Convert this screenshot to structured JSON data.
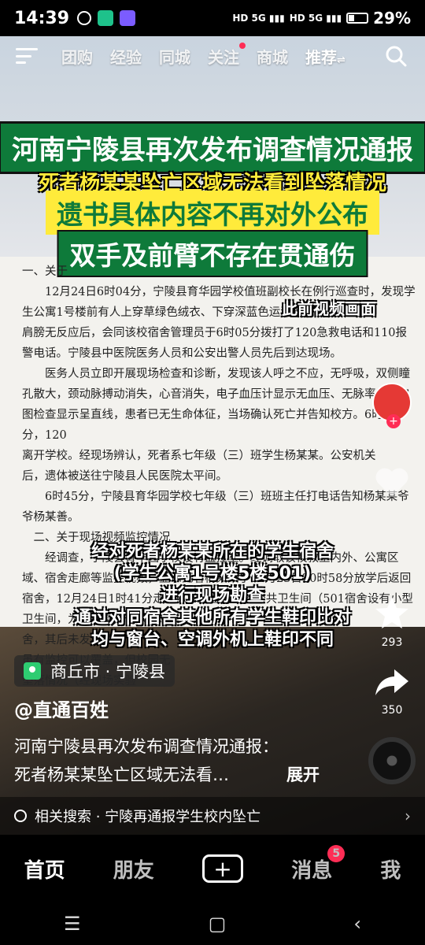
{
  "status": {
    "time": "14:39",
    "battery": "29%",
    "battery_level": 0.29
  },
  "nav": {
    "tabs": [
      "团购",
      "经验",
      "同城",
      "关注",
      "商城"
    ],
    "active": "推荐"
  },
  "headlines": {
    "h1": "河南宁陵县再次发布调查情况通报",
    "h2": "死者杨某某坠亡区域无法看到坠落情况",
    "h3": "遗书具体内容不再对外公布",
    "h4": "双手及前臂不存在贯通伤"
  },
  "document": {
    "paragraphs": [
      "一、关于",
      "12月24日6时04分，宁陵县育华园学校值班副校长在例行巡查时，发现学生公寓1号楼前有人上穿草绿色绒衣、下穿深蓝色运动裤侧卧在",
      "肩膀无反应后，会同该校宿舍管理员于6时05分拨打了120急救电话和110报警电话。宁陵县中医院医务人员和公安出警人员先后到达现场。",
      "医务人员立即开展现场检查和诊断，发现该人呼之不应，无呼吸，双侧瞳孔散大，颈动脉搏动消失，心音消失，电子血压计显示无血压、无脉率，心电图检查显示呈直线，患者已无生命体征，当场确认死亡并告知校方。6时39分，120",
      "离开学校。经现场辨认，死者系七年级（三）班学生杨某某。公安机关",
      "后，遗体被送往宁陵县人民医院太平间。",
      "6时45分，宁陵县育华园学校七年级（三）班班主任打电话告知杨某某爷爷杨某善。",
      "二、关于现场视频监控情况",
      "经调查，宁陵县育华园学校设有监控室。经调取该校教室内外、公寓区域、宿舍走廊等监控视频，显示死者杨某某于12月23日20时58分放学后返回宿舍，12月24日1时41分走出501宿舍去五楼公共卫生间（501宿舍设有小型卫生间，为避免影响他人休息、出",
      "舍，其后未发现杨某",
      "虽有监控可以覆盖，但校园无",
      "坠落情况（经现场实验"
    ]
  },
  "prev_label": "此前视频画面",
  "subtitles": [
    "经对死者杨某某所在的学生宿舍",
    "(学生公寓1号楼5楼501)",
    "进行现场勘查",
    "通过对同宿舍其他所有学生鞋印比对",
    "均与窗台、空调外机上鞋印不同"
  ],
  "rail": {
    "star_count": "293",
    "share_count": "350"
  },
  "location": "商丘市 · 宁陵县",
  "author": "@直通百姓",
  "desc": {
    "line1": "河南宁陵县再次发布调查情况通报：",
    "line2": "死者杨某某坠亡区域无法看…",
    "more": "展开"
  },
  "related": "相关搜索 · 宁陵再通报学生校内坠亡",
  "tabbar": {
    "home": "首页",
    "friends": "朋友",
    "messages": "消息",
    "messages_badge": "5",
    "me": "我"
  }
}
